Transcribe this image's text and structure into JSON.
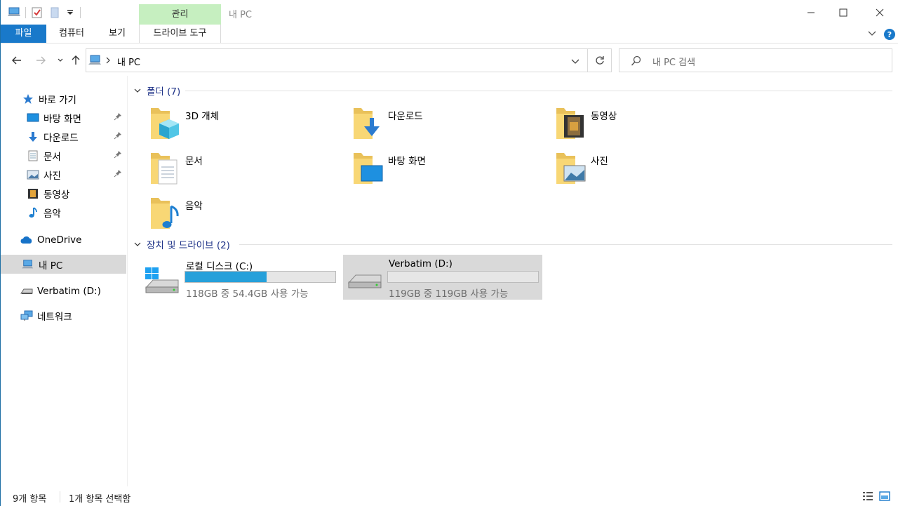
{
  "window": {
    "title": "내 PC",
    "context_tab_group": "관리"
  },
  "ribbon": {
    "tabs": [
      {
        "label": "파일"
      },
      {
        "label": "컴퓨터"
      },
      {
        "label": "보기"
      },
      {
        "label": "드라이브 도구"
      }
    ]
  },
  "address": {
    "path": "내 PC",
    "search_placeholder": "내 PC 검색"
  },
  "sidebar": {
    "quick_access": "바로 가기",
    "pinned": [
      {
        "label": "바탕 화면",
        "icon": "desktop-icon"
      },
      {
        "label": "다운로드",
        "icon": "download-icon"
      },
      {
        "label": "문서",
        "icon": "documents-icon"
      },
      {
        "label": "사진",
        "icon": "pictures-icon"
      }
    ],
    "unpinned": [
      {
        "label": "동영상",
        "icon": "videos-icon"
      },
      {
        "label": "음악",
        "icon": "music-icon"
      }
    ],
    "onedrive": "OneDrive",
    "this_pc": "내 PC",
    "drive_d": "Verbatim (D:)",
    "network": "네트워크"
  },
  "content": {
    "folders_header": "폴더 (7)",
    "folders": [
      {
        "name": "3D 개체",
        "icon": "3d-objects-icon"
      },
      {
        "name": "다운로드",
        "icon": "download-folder-icon"
      },
      {
        "name": "동영상",
        "icon": "videos-folder-icon"
      },
      {
        "name": "문서",
        "icon": "documents-folder-icon"
      },
      {
        "name": "바탕 화면",
        "icon": "desktop-folder-icon"
      },
      {
        "name": "사진",
        "icon": "pictures-folder-icon"
      },
      {
        "name": "음악",
        "icon": "music-folder-icon"
      }
    ],
    "drives_header": "장치 및 드라이브 (2)",
    "drives": [
      {
        "name": "로컬 디스크 (C:)",
        "free_text": "118GB 중 54.4GB 사용 가능",
        "used_fraction": 0.54
      },
      {
        "name": "Verbatim (D:)",
        "free_text": "119GB 중 119GB 사용 가능",
        "used_fraction": 0.0
      }
    ]
  },
  "status": {
    "item_count": "9개 항목",
    "selection": "1개 항목 선택함"
  },
  "colors": {
    "accent": "#1979ca",
    "group_header": "#1e3287",
    "drive_bar": "#26a0da",
    "context_tab": "#c6efc0"
  }
}
